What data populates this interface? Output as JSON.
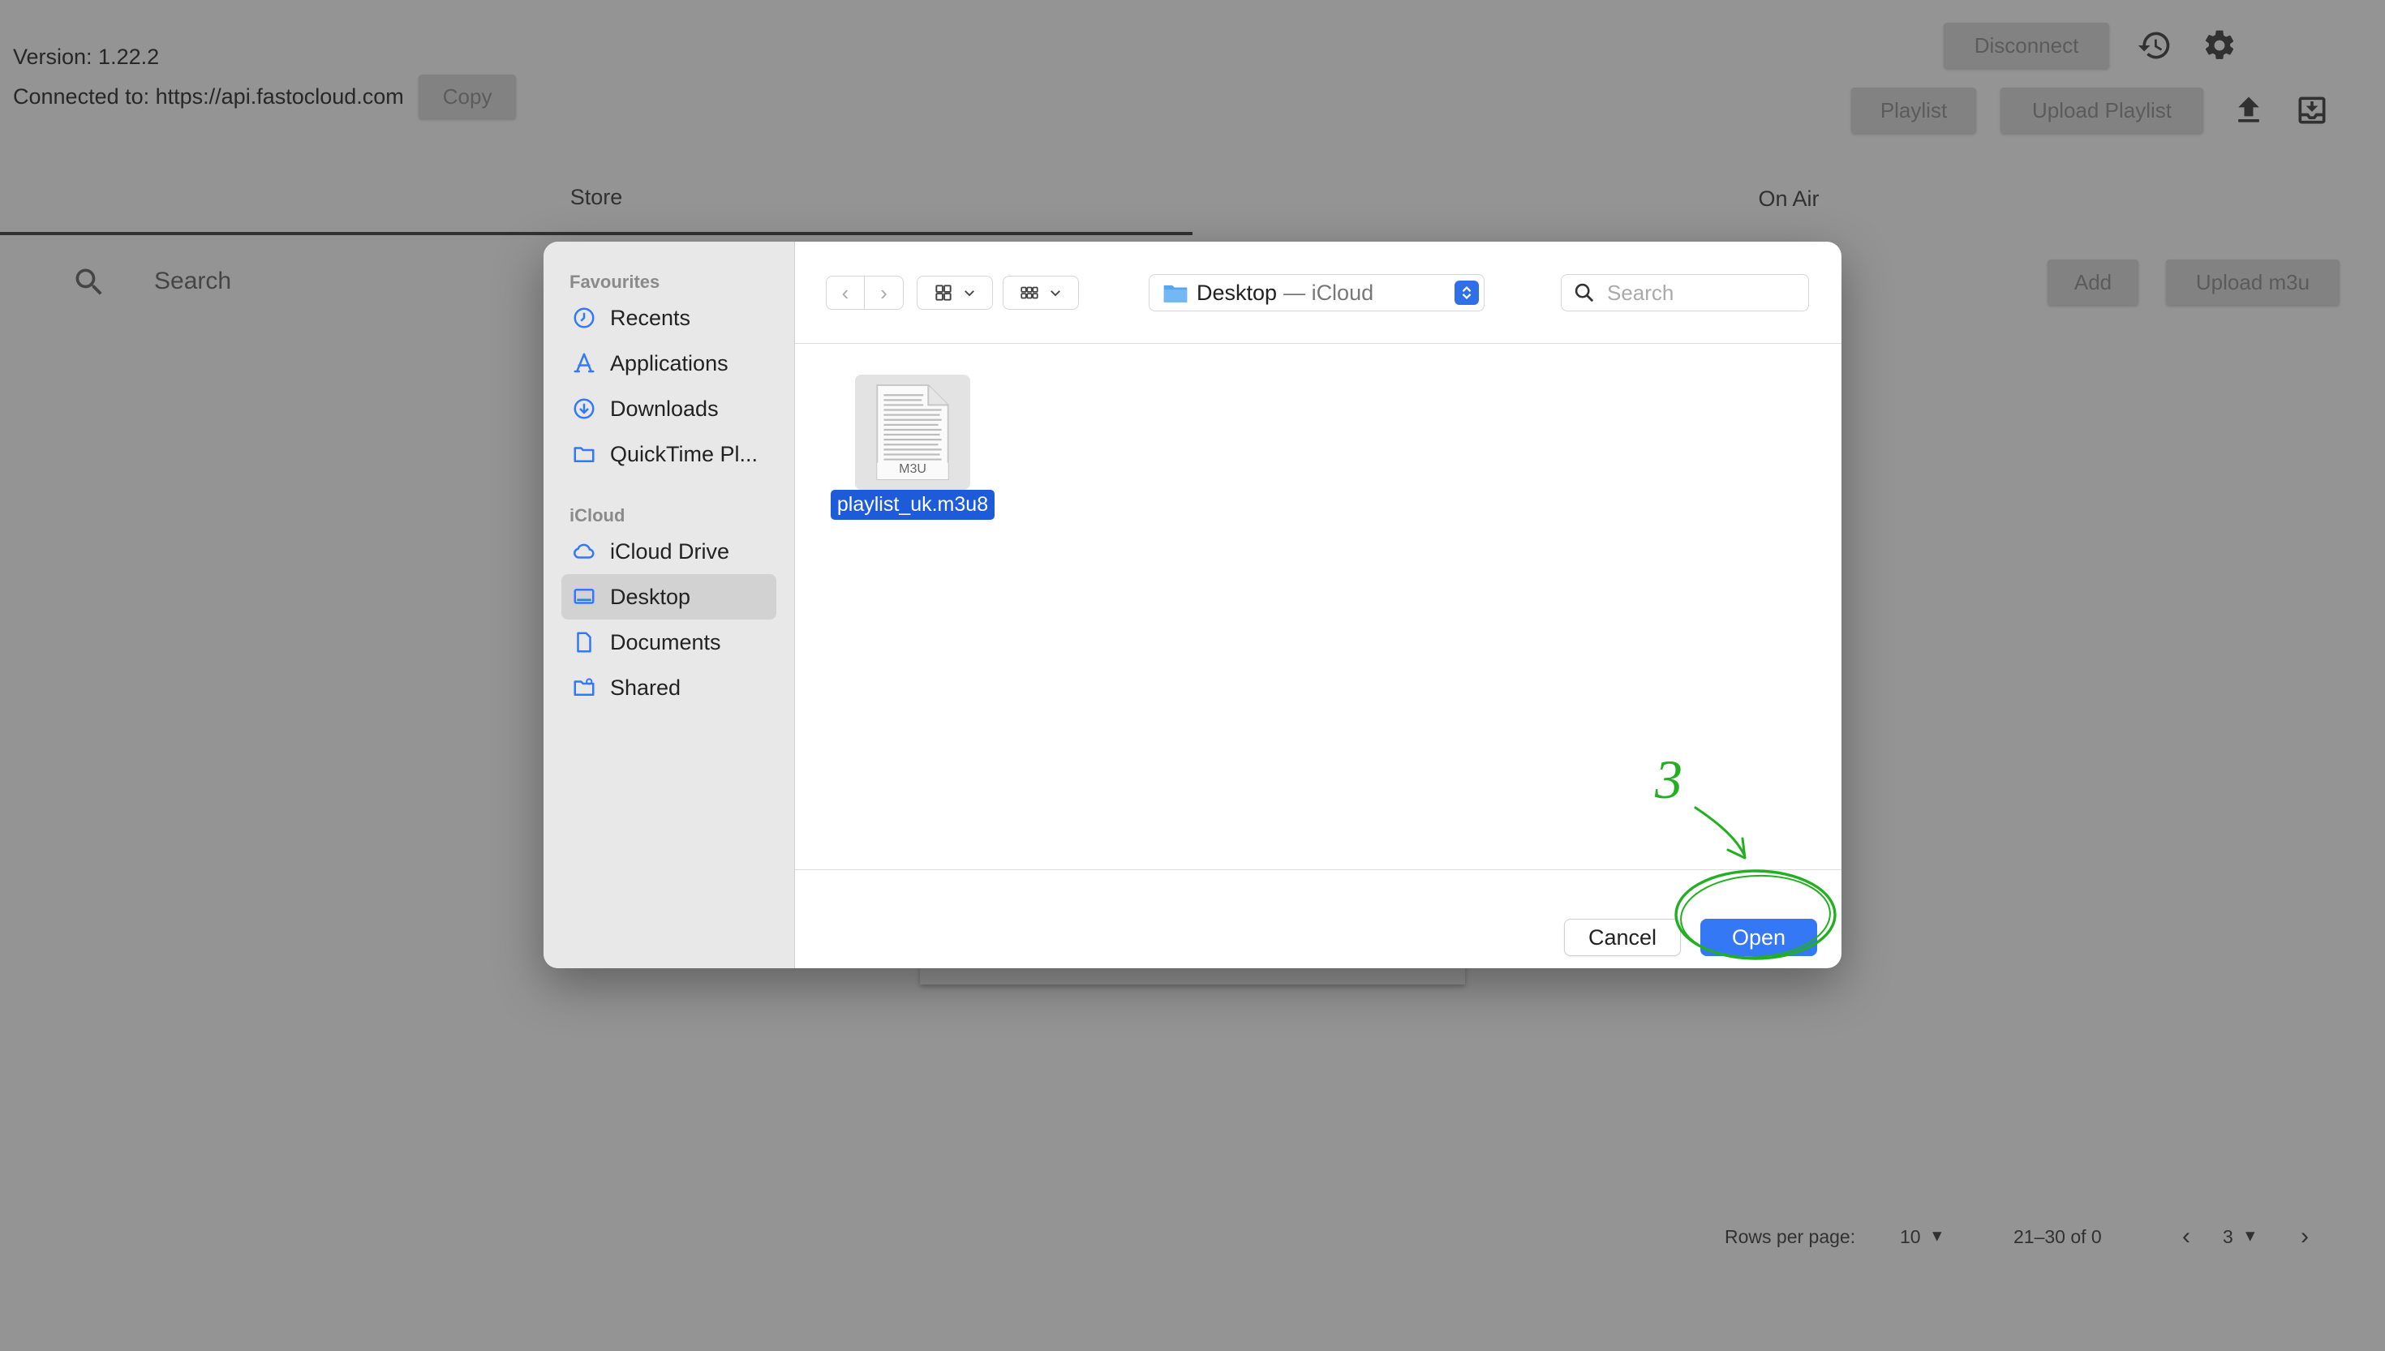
{
  "app": {
    "version_text": "Version: 1.22.2",
    "connected_text": "Connected to: https://api.fastocloud.com",
    "copy_label": "Copy",
    "disconnect_label": "Disconnect",
    "playlist_label": "Playlist",
    "upload_playlist_label": "Upload Playlist",
    "tabs": [
      {
        "label": "Store"
      },
      {
        "label": "On Air"
      }
    ],
    "search_placeholder": "Search",
    "add_label": "Add",
    "upload_m3u_label": "Upload m3u",
    "pagination": {
      "rows_per_page_label": "Rows per page:",
      "rows_per_page_value": "10",
      "range_text": "21–30 of 0",
      "page_value": "3"
    }
  },
  "dialog": {
    "sidebar": {
      "favourites_heading": "Favourites",
      "favourites": [
        {
          "label": "Recents",
          "icon": "clock-icon"
        },
        {
          "label": "Applications",
          "icon": "applications-icon"
        },
        {
          "label": "Downloads",
          "icon": "download-circle-icon"
        },
        {
          "label": "QuickTime Pl...",
          "icon": "folder-icon"
        }
      ],
      "icloud_heading": "iCloud",
      "icloud": [
        {
          "label": "iCloud Drive",
          "icon": "cloud-icon"
        },
        {
          "label": "Desktop",
          "icon": "desktop-icon",
          "selected": true
        },
        {
          "label": "Documents",
          "icon": "document-icon"
        },
        {
          "label": "Shared",
          "icon": "shared-folder-icon"
        }
      ]
    },
    "location": {
      "name": "Desktop",
      "suffix": "— iCloud"
    },
    "search_placeholder": "Search",
    "files": [
      {
        "name": "playlist_uk.m3u8",
        "type_label": "M3U",
        "selected": true
      }
    ],
    "cancel_label": "Cancel",
    "open_label": "Open"
  },
  "annotation": {
    "step_number": "3",
    "color": "#22b022"
  }
}
